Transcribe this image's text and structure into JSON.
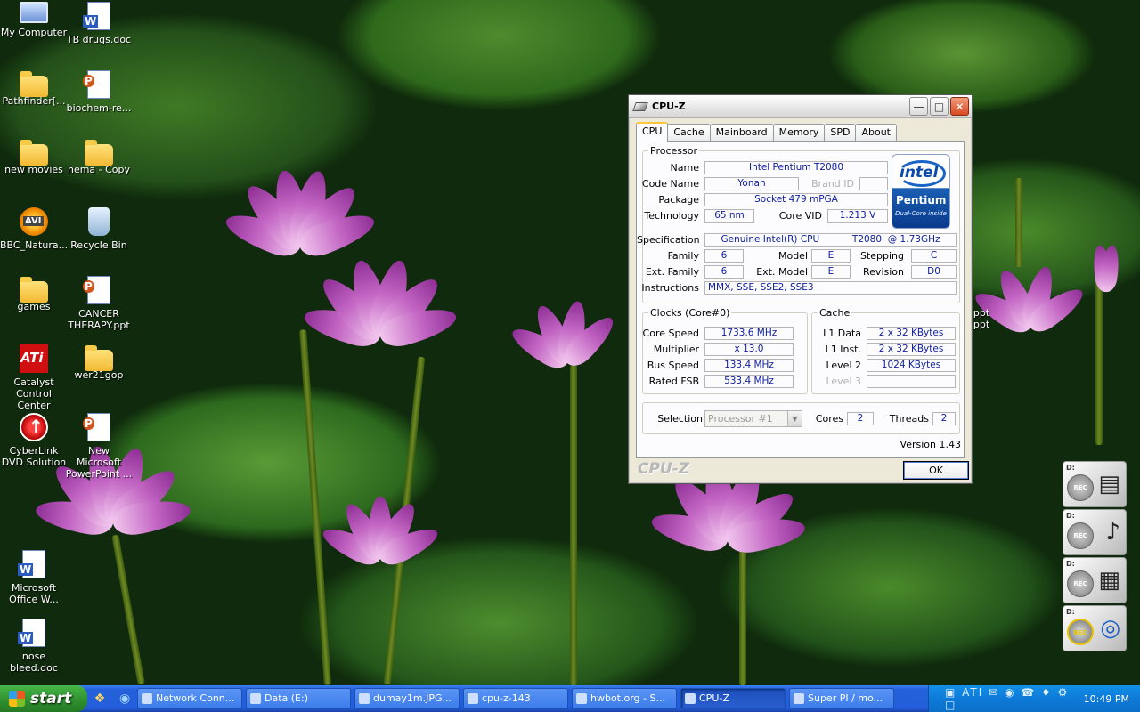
{
  "desktop_icons": [
    {
      "label": "My Computer",
      "icon": "computer-icon"
    },
    {
      "label": "TB drugs.doc",
      "icon": "word-doc-icon"
    },
    {
      "label": "Pathfinder[...",
      "icon": "folder-icon"
    },
    {
      "label": "biochem-re...",
      "icon": "powerpoint-icon"
    },
    {
      "label": "new movies",
      "icon": "folder-icon"
    },
    {
      "label": "hema - Copy",
      "icon": "folder-icon"
    },
    {
      "label": "BBC_Natura...",
      "icon": "avi-icon"
    },
    {
      "label": "Recycle Bin",
      "icon": "recycle-bin-icon"
    },
    {
      "label": "games",
      "icon": "folder-icon"
    },
    {
      "label": "CANCER THERAPY.ppt",
      "icon": "powerpoint-icon"
    },
    {
      "label": "Catalyst Control Center",
      "icon": "ati-icon"
    },
    {
      "label": "wer21gop",
      "icon": "folder-icon"
    },
    {
      "label": "CyberLink DVD Solution",
      "icon": "cyberlink-icon"
    },
    {
      "label": "New Microsoft PowerPoint ...",
      "icon": "powerpoint-icon"
    },
    {
      "label": "Microsoft Office W...",
      "icon": "word-doc-icon"
    },
    {
      "label": "nose bleed.doc",
      "icon": "word-doc-icon"
    }
  ],
  "hidden_icon_label": "ppt",
  "hidden_icon_label2": "ppt",
  "window": {
    "title": "CPU-Z",
    "tabs": [
      "CPU",
      "Cache",
      "Mainboard",
      "Memory",
      "SPD",
      "About"
    ],
    "active_tab": "CPU",
    "processor": {
      "legend": "Processor",
      "name_label": "Name",
      "name": "Intel Pentium T2080",
      "codename_label": "Code Name",
      "codename": "Yonah",
      "brandid_label": "Brand ID",
      "brandid": "",
      "package_label": "Package",
      "package": "Socket 479 mPGA",
      "technology_label": "Technology",
      "technology": "65 nm",
      "corevid_label": "Core VID",
      "corevid": "1.213 V",
      "spec_label": "Specification",
      "spec": "Genuine Intel(R) CPU           T2080  @ 1.73GHz",
      "family_label": "Family",
      "family": "6",
      "model_label": "Model",
      "model": "E",
      "stepping_label": "Stepping",
      "stepping": "C",
      "extfamily_label": "Ext. Family",
      "extfamily": "6",
      "extmodel_label": "Ext. Model",
      "extmodel": "E",
      "revision_label": "Revision",
      "revision": "D0",
      "instructions_label": "Instructions",
      "instructions": "MMX, SSE, SSE2, SSE3",
      "logo": {
        "brand": "intel",
        "product": "Pentium",
        "sub": "Dual-Core inside"
      }
    },
    "clocks": {
      "legend": "Clocks (Core#0)",
      "corespeed_label": "Core Speed",
      "corespeed": "1733.6 MHz",
      "multiplier_label": "Multiplier",
      "multiplier": "x 13.0",
      "busspeed_label": "Bus Speed",
      "busspeed": "133.4 MHz",
      "ratedfsb_label": "Rated FSB",
      "ratedfsb": "533.4 MHz"
    },
    "cache": {
      "legend": "Cache",
      "l1data_label": "L1 Data",
      "l1data": "2 x 32 KBytes",
      "l1inst_label": "L1 Inst.",
      "l1inst": "2 x 32 KBytes",
      "level2_label": "Level 2",
      "level2": "1024 KBytes",
      "level3_label": "Level 3",
      "level3": ""
    },
    "selection": {
      "label": "Selection",
      "value": "Processor #1",
      "cores_label": "Cores",
      "cores": "2",
      "threads_label": "Threads",
      "threads": "2"
    },
    "version": "Version 1.43",
    "logo_text": "CPU-Z",
    "ok_label": "OK"
  },
  "gadget": {
    "drive_label": "D:",
    "rec_label": "REC"
  },
  "taskbar": {
    "start_label": "start",
    "tasks": [
      "Network Conn...",
      "Data (E:)",
      "dumay1m.JPG...",
      "cpu-z-143",
      "hwbot.org - S...",
      "CPU-Z",
      "Super PI / mo..."
    ],
    "active_task": "CPU-Z",
    "tray_tray_icons": "▣ ATI ✉ ◉ ☎ ♦ ⚙ □",
    "clock": "10:49 PM"
  },
  "colors": {
    "value_text": "#1020a0",
    "taskbar": "#245edb",
    "start": "#2e8e2e"
  }
}
